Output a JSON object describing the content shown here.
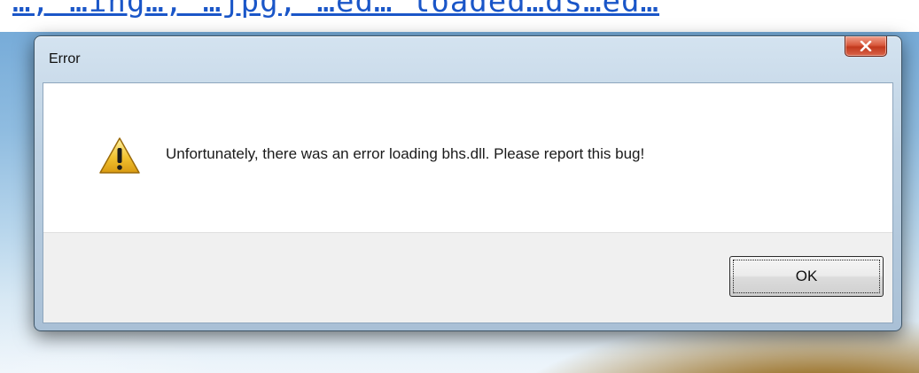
{
  "background": {
    "cut_off_text": "…, …ing…, …jpg, …ed… loaded…ds…ed…"
  },
  "dialog": {
    "title": "Error",
    "close_button": {
      "icon": "close-icon",
      "color": "#c2391d"
    },
    "message": {
      "icon": "warning-icon",
      "icon_color": "#f2c230",
      "text": "Unfortunately, there was an error loading bhs.dll. Please report this bug!"
    },
    "ok_button": {
      "label": "OK"
    }
  }
}
